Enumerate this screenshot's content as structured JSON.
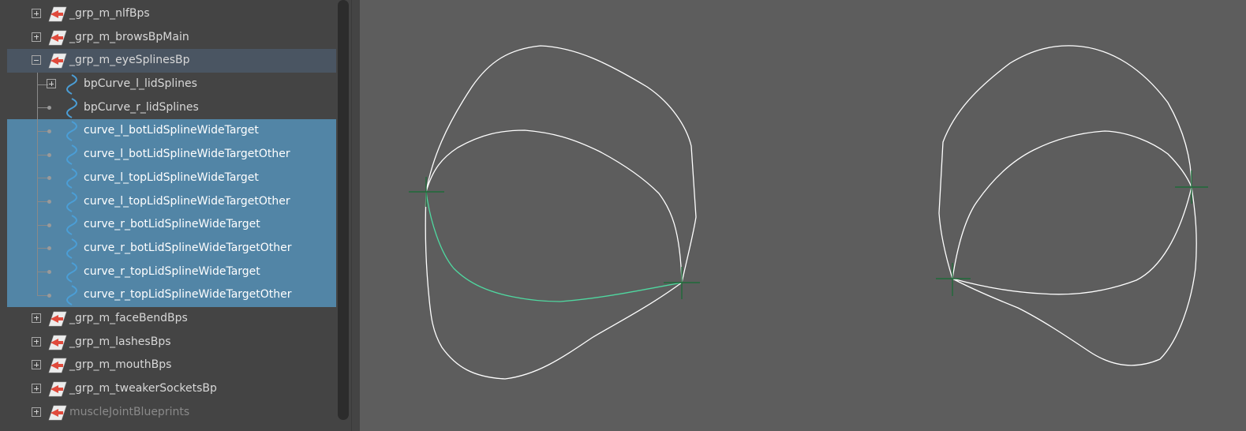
{
  "outliner": {
    "items": [
      {
        "label": "_grp_m_nlfBps",
        "kind": "group",
        "expander": "plus",
        "state": "normal",
        "icon": "transform-icon"
      },
      {
        "label": "_grp_m_browsBpMain",
        "kind": "group",
        "expander": "plus",
        "state": "normal",
        "icon": "transform-icon"
      },
      {
        "label": "_grp_m_eyeSplinesBp",
        "kind": "group",
        "expander": "minus",
        "state": "highlighted",
        "icon": "transform-icon"
      },
      {
        "label": "bpCurve_l_lidSplines",
        "kind": "child",
        "expander": "plus",
        "state": "normal",
        "icon": "curve-icon"
      },
      {
        "label": "bpCurve_r_lidSplines",
        "kind": "child",
        "expander": "none",
        "state": "normal",
        "icon": "curve-icon"
      },
      {
        "label": "curve_l_botLidSplineWideTarget",
        "kind": "child",
        "expander": "none",
        "state": "selected",
        "icon": "curve-icon"
      },
      {
        "label": "curve_l_botLidSplineWideTargetOther",
        "kind": "child",
        "expander": "none",
        "state": "selected",
        "icon": "curve-icon"
      },
      {
        "label": "curve_l_topLidSplineWideTarget",
        "kind": "child",
        "expander": "none",
        "state": "selected",
        "icon": "curve-icon"
      },
      {
        "label": "curve_l_topLidSplineWideTargetOther",
        "kind": "child",
        "expander": "none",
        "state": "selected",
        "icon": "curve-icon"
      },
      {
        "label": "curve_r_botLidSplineWideTarget",
        "kind": "child",
        "expander": "none",
        "state": "selected",
        "icon": "curve-icon"
      },
      {
        "label": "curve_r_botLidSplineWideTargetOther",
        "kind": "child",
        "expander": "none",
        "state": "selected",
        "icon": "curve-icon"
      },
      {
        "label": "curve_r_topLidSplineWideTarget",
        "kind": "child",
        "expander": "none",
        "state": "selected",
        "icon": "curve-icon"
      },
      {
        "label": "curve_r_topLidSplineWideTargetOther",
        "kind": "child",
        "expander": "none",
        "state": "selected",
        "icon": "curve-icon"
      },
      {
        "label": "_grp_m_faceBendBps",
        "kind": "group",
        "expander": "plus",
        "state": "normal",
        "icon": "transform-icon"
      },
      {
        "label": "_grp_m_lashesBps",
        "kind": "group",
        "expander": "plus",
        "state": "normal",
        "icon": "transform-icon"
      },
      {
        "label": "_grp_m_mouthBps",
        "kind": "group",
        "expander": "plus",
        "state": "normal",
        "icon": "transform-icon"
      },
      {
        "label": "_grp_m_tweakerSocketsBp",
        "kind": "group",
        "expander": "plus",
        "state": "normal",
        "icon": "transform-icon"
      },
      {
        "label": "muscleJointBlueprints",
        "kind": "group",
        "expander": "plus",
        "state": "dimmed",
        "icon": "transform-icon"
      }
    ]
  },
  "colors": {
    "outliner_bg": "#444444",
    "selection": "#5285a6",
    "highlight": "#4a5562",
    "viewport_bg": "#5d5d5d",
    "curve": "#ffffff",
    "active_curve": "#4fd8a0",
    "pivot": "#1f6b3a",
    "curve_icon": "#4b9ed6",
    "transform_icon_arrow": "#e04a3c"
  }
}
